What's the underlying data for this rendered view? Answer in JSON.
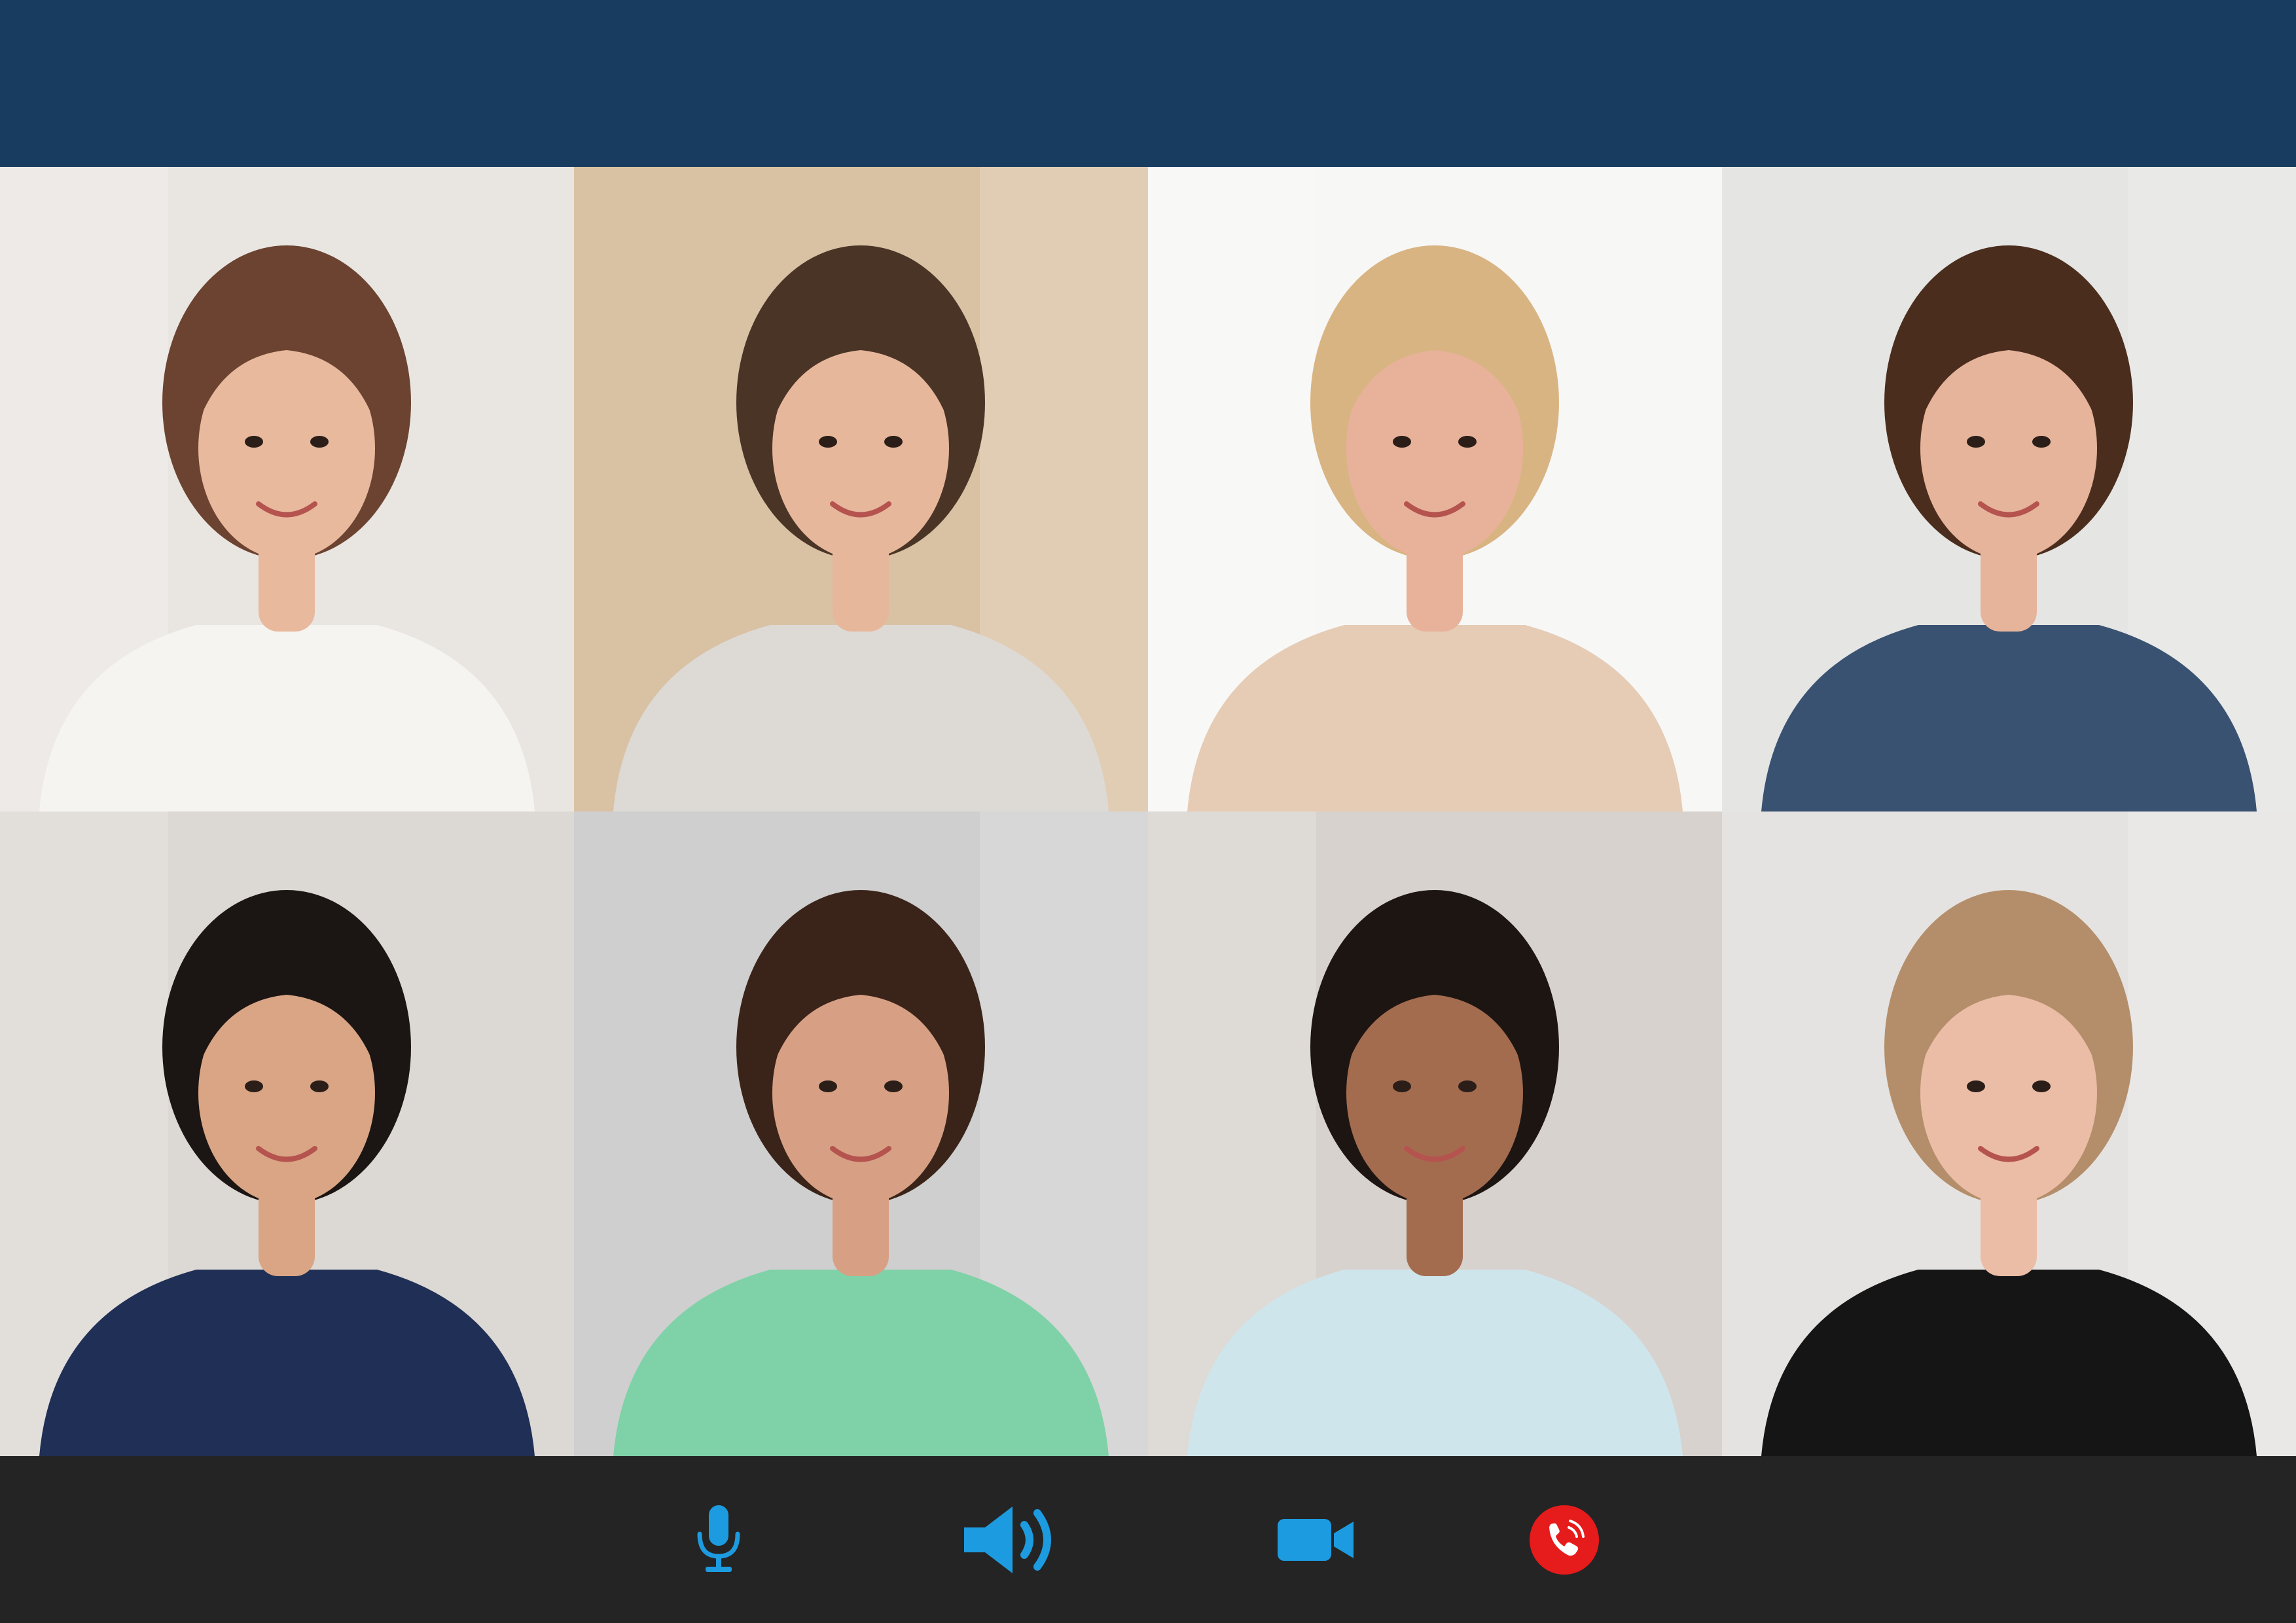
{
  "window": {
    "header_color": "#183c5f",
    "controls_bg": "#242424"
  },
  "participants": [
    {
      "id": "p1",
      "description_icon": "participant-video",
      "bg": "#e9e6e2",
      "shirt": "#f6f4f1",
      "hair": "#6b4330",
      "skin": "#e8b99d"
    },
    {
      "id": "p2",
      "description_icon": "participant-video",
      "bg": "#d9c2a4",
      "shirt": "#dddad6",
      "hair": "#4a3426",
      "skin": "#e7b79c"
    },
    {
      "id": "p3",
      "description_icon": "participant-video",
      "bg": "#f7f7f6",
      "shirt": "#e6cbb5",
      "hair": "#d9b483",
      "skin": "#e8b29a"
    },
    {
      "id": "p4",
      "description_icon": "participant-video",
      "bg": "#e5e6e3",
      "shirt": "#3a5272",
      "hair": "#4b2d1e",
      "skin": "#e6b49b"
    },
    {
      "id": "p5",
      "description_icon": "participant-video",
      "bg": "#dcd8d3",
      "shirt": "#1f2f55",
      "hair": "#1b1513",
      "skin": "#d9a585"
    },
    {
      "id": "p6",
      "description_icon": "participant-video",
      "bg": "#cfcfcf",
      "shirt": "#7fd1a8",
      "hair": "#3a2419",
      "skin": "#d7a085"
    },
    {
      "id": "p7",
      "description_icon": "participant-video",
      "bg": "#d7d2cd",
      "shirt": "#cfe5ec",
      "hair": "#1d1512",
      "skin": "#a46c4f"
    },
    {
      "id": "p8",
      "description_icon": "participant-video",
      "bg": "#e4e3e1",
      "shirt": "#151515",
      "hair": "#b48e6a",
      "skin": "#ebbda6"
    }
  ],
  "controls": {
    "mic": {
      "icon": "microphone-icon",
      "color": "#1d9be0"
    },
    "speaker": {
      "icon": "speaker-icon",
      "color": "#1d9be0"
    },
    "camera": {
      "icon": "video-camera-icon",
      "color": "#1d9be0"
    },
    "end_call": {
      "icon": "end-call-icon",
      "color": "#e61b1b"
    }
  }
}
